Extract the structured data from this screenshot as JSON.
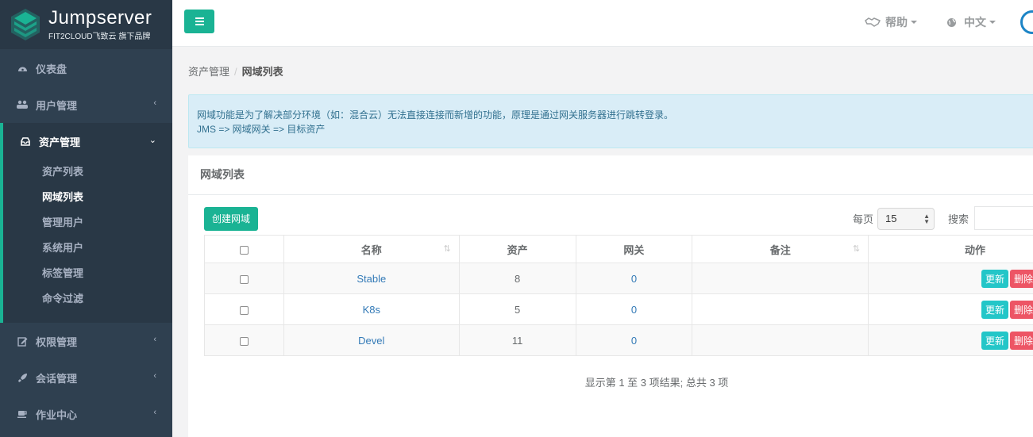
{
  "brand": {
    "title": "Jumpserver",
    "subtitle": "FIT2CLOUD飞致云 旗下品牌"
  },
  "sidebar": {
    "items": [
      {
        "label": "仪表盘",
        "icon": "dashboard-icon"
      },
      {
        "label": "用户管理",
        "icon": "users-icon"
      },
      {
        "label": "资产管理",
        "icon": "inbox-icon"
      },
      {
        "label": "权限管理",
        "icon": "edit-icon"
      },
      {
        "label": "会话管理",
        "icon": "rocket-icon"
      },
      {
        "label": "作业中心",
        "icon": "coffee-icon"
      }
    ],
    "asset_sub": [
      "资产列表",
      "网域列表",
      "管理用户",
      "系统用户",
      "标签管理",
      "命令过滤"
    ]
  },
  "topbar": {
    "help": "帮助",
    "lang": "中文"
  },
  "breadcrumb": {
    "parent": "资产管理",
    "separator": "/",
    "current": "网域列表"
  },
  "alert": {
    "line1": "网域功能是为了解决部分环境（如：混合云）无法直接连接而新增的功能，原理是通过网关服务器进行跳转登录。",
    "line2": "JMS => 网域网关 => 目标资产"
  },
  "panel": {
    "title": "网域列表",
    "create_label": "创建网域",
    "per_page_label": "每页",
    "per_page_value": "15",
    "search_label": "搜索"
  },
  "table": {
    "headers": [
      "名称",
      "资产",
      "网关",
      "备注",
      "动作"
    ],
    "rows": [
      {
        "name": "Stable",
        "assets": "8",
        "gateways": "0",
        "comment": ""
      },
      {
        "name": "K8s",
        "assets": "5",
        "gateways": "0",
        "comment": ""
      },
      {
        "name": "Devel",
        "assets": "11",
        "gateways": "0",
        "comment": ""
      }
    ],
    "update_label": "更新",
    "delete_label": "删除"
  },
  "pager": {
    "info": "显示第 1 至 3 项结果; 总共 3 项"
  }
}
